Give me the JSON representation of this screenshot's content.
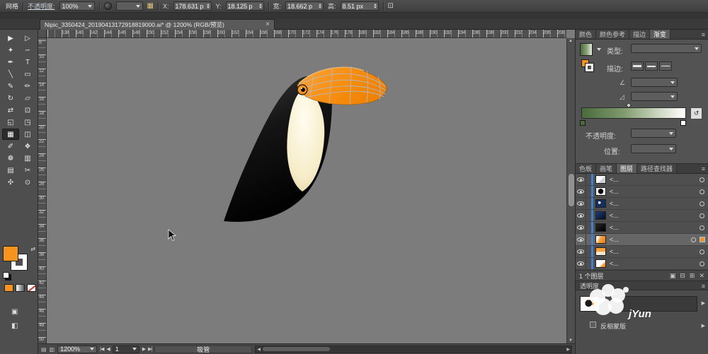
{
  "control_bar": {
    "tool_name": "网格",
    "opacity_label": "不透明度:",
    "opacity_value": "100%",
    "x_label": "X:",
    "x_value": "178.631 p",
    "y_label": "Y:",
    "y_value": "18.125 p",
    "w_label": "宽:",
    "w_value": "18.662 p",
    "h_label": "高:",
    "h_value": "8.51 px"
  },
  "document_tab": {
    "title": "Nipic_3350424_20190413172918819000.ai* @ 1200% (RGB/预览)",
    "close_glyph": "×"
  },
  "toolbar": {
    "tools": [
      {
        "name": "selection-tool",
        "glyph": "▶"
      },
      {
        "name": "direct-selection-tool",
        "glyph": "▷"
      },
      {
        "name": "magic-wand-tool",
        "glyph": "✦"
      },
      {
        "name": "lasso-tool",
        "glyph": "∽"
      },
      {
        "name": "pen-tool",
        "glyph": "✒"
      },
      {
        "name": "type-tool",
        "glyph": "T"
      },
      {
        "name": "line-segment-tool",
        "glyph": "╲"
      },
      {
        "name": "rectangle-tool",
        "glyph": "▭"
      },
      {
        "name": "paintbrush-tool",
        "glyph": "✎"
      },
      {
        "name": "pencil-tool",
        "glyph": "✏"
      },
      {
        "name": "rotate-tool",
        "glyph": "↻"
      },
      {
        "name": "scale-tool",
        "glyph": "▱"
      },
      {
        "name": "width-tool",
        "glyph": "⇄"
      },
      {
        "name": "free-transform-tool",
        "glyph": "⊡"
      },
      {
        "name": "shape-builder-tool",
        "glyph": "◱"
      },
      {
        "name": "perspective-grid-tool",
        "glyph": "◳"
      },
      {
        "name": "mesh-tool",
        "glyph": "▦",
        "active": true
      },
      {
        "name": "gradient-tool",
        "glyph": "◫"
      },
      {
        "name": "eyedropper-tool",
        "glyph": "✐"
      },
      {
        "name": "blend-tool",
        "glyph": "❖"
      },
      {
        "name": "symbol-sprayer-tool",
        "glyph": "❁"
      },
      {
        "name": "column-graph-tool",
        "glyph": "▥"
      },
      {
        "name": "artboard-tool",
        "glyph": "▤"
      },
      {
        "name": "slice-tool",
        "glyph": "✂"
      },
      {
        "name": "hand-tool",
        "glyph": "✣"
      },
      {
        "name": "zoom-tool",
        "glyph": "⊙"
      }
    ]
  },
  "rulers": {
    "top": {
      "start": 138,
      "step": 2,
      "count": 36
    },
    "left": {
      "start": 8,
      "step": 2,
      "count": 22
    }
  },
  "gradient_panel": {
    "tabs": [
      {
        "label": "颜色"
      },
      {
        "label": "颜色参考"
      },
      {
        "label": "描边"
      },
      {
        "label": "渐变",
        "active": true
      }
    ],
    "type_label": "类型:",
    "stroke_label": "描边:",
    "opacity_label": "不透明度:",
    "location_label": "位置:"
  },
  "layers_panel": {
    "tabs": [
      {
        "label": "色板"
      },
      {
        "label": "画笔"
      },
      {
        "label": "图层",
        "active": true
      },
      {
        "label": "路径查找器"
      }
    ],
    "rows": [
      {
        "label": "<...",
        "thumb": "mesh"
      },
      {
        "label": "<...",
        "thumb": "black-circle"
      },
      {
        "label": "<...",
        "thumb": "navy-crescent"
      },
      {
        "label": "<...",
        "thumb": "navy"
      },
      {
        "label": "<...",
        "thumb": "black"
      },
      {
        "label": "<...",
        "thumb": "orange-beak",
        "selected": true
      },
      {
        "label": "<...",
        "thumb": "orange-white"
      },
      {
        "label": "<...",
        "thumb": "white"
      }
    ],
    "count_label": "1 个图层",
    "footer_icons": [
      {
        "name": "clipping-mask-icon",
        "glyph": "▣"
      },
      {
        "name": "new-sublayer-icon",
        "glyph": "⊟"
      },
      {
        "name": "new-layer-icon",
        "glyph": "⊞"
      },
      {
        "name": "delete-layer-icon",
        "glyph": "✕"
      }
    ]
  },
  "transparency_panel": {
    "header": "透明度",
    "invert_mask_label": "反相蒙版"
  },
  "status_bar": {
    "zoom": "1200%",
    "page": "1",
    "tool_status": "吸管"
  },
  "watermark": {
    "text": "jYun"
  },
  "icons": {
    "menu": "≡",
    "recolor": "▦",
    "transform": "⊡",
    "swap": "⇄",
    "nav_first": "|◀",
    "nav_prev": "◀",
    "nav_next": "▶",
    "nav_last": "▶|",
    "scroll_up": "▲",
    "scroll_down": "▼",
    "scroll_left": "◀",
    "scroll_right": "▶",
    "gradient_reverse": "↺",
    "flyout": "▶",
    "angle": "∠",
    "corner": "◿",
    "doc_icon1": "▤",
    "doc_icon2": "▥",
    "draw_mode": "▣",
    "screen_mode": "◧"
  },
  "colors": {
    "accent_orange": "#f7941d",
    "selection_blue": "#3f7fd6",
    "gradient_green": "#4a6b3c"
  }
}
